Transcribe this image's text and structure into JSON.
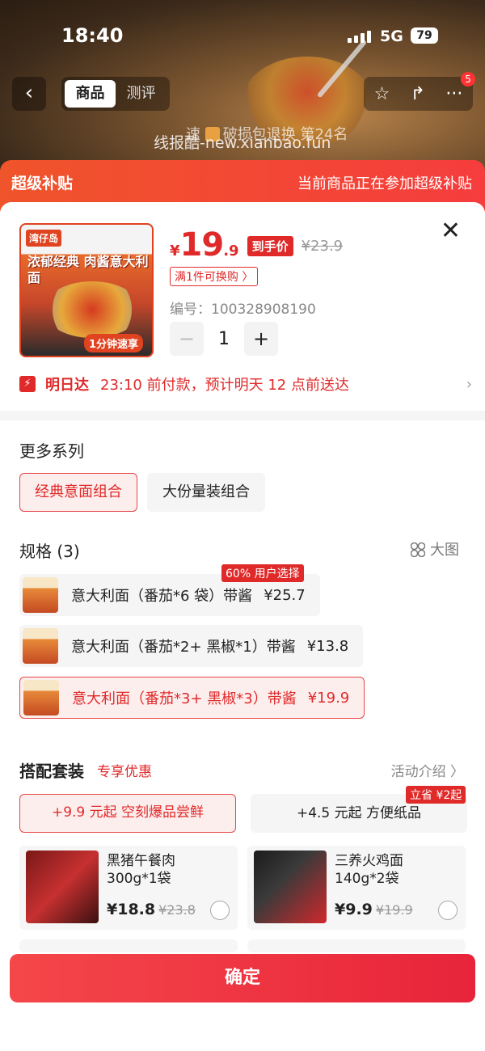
{
  "status_bar": {
    "time": "18:40",
    "network": "5G",
    "battery": "79"
  },
  "nav": {
    "back_glyph": "‹",
    "tabs": [
      {
        "label": "商品",
        "active": true
      },
      {
        "label": "测评",
        "active": false
      }
    ],
    "actions": {
      "favorite_glyph": "☆",
      "share_glyph": "↱",
      "more_glyph": "···",
      "message_count": "5"
    }
  },
  "hero": {
    "ranking_prefix": "速",
    "ranking_text": "破损包退换",
    "ranking_suffix": "第24名",
    "watermark": "线报酷-new.xianbao.fun"
  },
  "subsidy": {
    "left": "超级补贴",
    "right": "当前商品正在参加超级补贴"
  },
  "product": {
    "brand_tag": "湾仔岛",
    "image_caption": "浓郁经典 肉酱意大利面",
    "image_footer": "1分钟速享",
    "price_currency": "¥",
    "price_int": "19",
    "price_dec": ".9",
    "price_tag": "到手价",
    "original_price": "¥23.9",
    "promo": "满1件可换购 〉",
    "sku_label": "编号：",
    "sku_number": "100328908190",
    "quantity": "1",
    "minus": "−",
    "plus": "+"
  },
  "close_glyph": "✕",
  "delivery": {
    "icon_glyph": "⚡",
    "title": "明日达",
    "text": "23:10 前付款，预计明天 12 点前送达",
    "chevron": "›"
  },
  "series": {
    "title": "更多系列",
    "options": [
      {
        "label": "经典意面组合",
        "active": true
      },
      {
        "label": "大份量装组合",
        "active": false
      }
    ]
  },
  "specs": {
    "title": "规格 (3)",
    "big_image_label": "大图",
    "popular_badge": "60% 用户选择",
    "items": [
      {
        "label": "意大利面（番茄*6 袋）带酱",
        "price": "¥25.7",
        "active": false
      },
      {
        "label": "意大利面（番茄*2+ 黑椒*1）带酱",
        "price": "¥13.8",
        "active": false
      },
      {
        "label": "意大利面（番茄*3+ 黑椒*3）带酱",
        "price": "¥19.9",
        "active": true
      }
    ]
  },
  "bundle": {
    "title": "搭配套装",
    "subtitle": "专享优惠",
    "intro": "活动介绍 〉",
    "save_badge": "立省 ¥2起",
    "tabs": [
      {
        "label": "+9.9 元起  空刻爆品尝鲜",
        "active": true
      },
      {
        "label": "+4.5 元起  方便纸品",
        "active": false
      }
    ],
    "products": [
      {
        "name": "黑猪午餐肉 300g*1袋",
        "price": "¥18.8",
        "original": "¥23.8"
      },
      {
        "name": "三养火鸡面 140g*2袋",
        "price": "¥9.9",
        "original": "¥19.9"
      }
    ]
  },
  "confirm_label": "确定",
  "colors": {
    "accent": "#e02a2a",
    "subsidy_bar": "#f0542b",
    "confirm": "#f5474a"
  }
}
